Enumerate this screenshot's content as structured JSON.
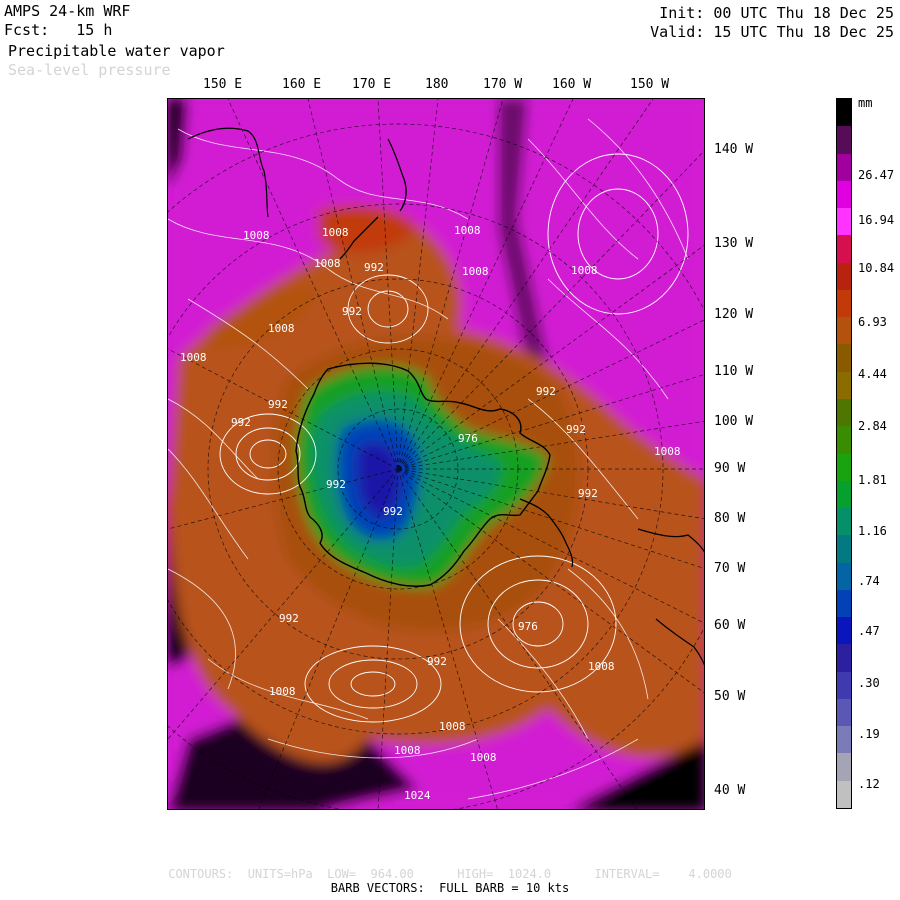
{
  "header": {
    "model": "AMPS 24-km WRF",
    "forecast": "Fcst:   15 h",
    "field1": "Precipitable water vapor",
    "field2": "Sea-level pressure",
    "init": "Init: 00 UTC Thu 18 Dec 25",
    "valid": "Valid: 15 UTC Thu 18 Dec 25"
  },
  "longitude_labels": [
    "150 E",
    "160 E",
    "170 E",
    "180",
    "170 W",
    "160 W",
    "150 W"
  ],
  "latitude_labels": [
    "140 W",
    "130 W",
    "120 W",
    "110 W",
    "100 W",
    "90 W",
    "80 W",
    "70 W",
    "60 W",
    "50 W",
    "40 W"
  ],
  "legend": {
    "unit": "mm",
    "labels": [
      "26.47",
      "16.94",
      "10.84",
      "6.93",
      "4.44",
      "2.84",
      "1.81",
      "1.16",
      ".74",
      ".47",
      ".30",
      ".19",
      ".12"
    ],
    "colors_top_to_bottom": [
      "#000000",
      "#560c56",
      "#a2009e",
      "#e000e0",
      "#ff33ff",
      "#d6104f",
      "#b8230f",
      "#c23a0a",
      "#b3520c",
      "#8a5a00",
      "#8a6c00",
      "#4f7600",
      "#3a8c00",
      "#18a30f",
      "#07a02f",
      "#06906a",
      "#037a82",
      "#0565a4",
      "#0342b6",
      "#0a15bc",
      "#2c1fa0",
      "#403ab0",
      "#5a58b4",
      "#7b7bb8",
      "#a4a4b4",
      "#c0c0c0"
    ]
  },
  "pressure_labels": [
    "1008",
    "1008",
    "1008",
    "1008",
    "1008",
    "1008",
    "1008",
    "1008",
    "992",
    "992",
    "992",
    "992",
    "992",
    "992",
    "992",
    "992",
    "992",
    "992",
    "992",
    "976",
    "976",
    "1008",
    "1008",
    "1008",
    "1008",
    "1008",
    "1024",
    "1008"
  ],
  "footer": {
    "contours": "CONTOURS:  UNITS=hPa  LOW=  964.00      HIGH=  1024.0      INTERVAL=    4.0000",
    "barbs": "BARB VECTORS:  FULL BARB = 10 kts"
  }
}
